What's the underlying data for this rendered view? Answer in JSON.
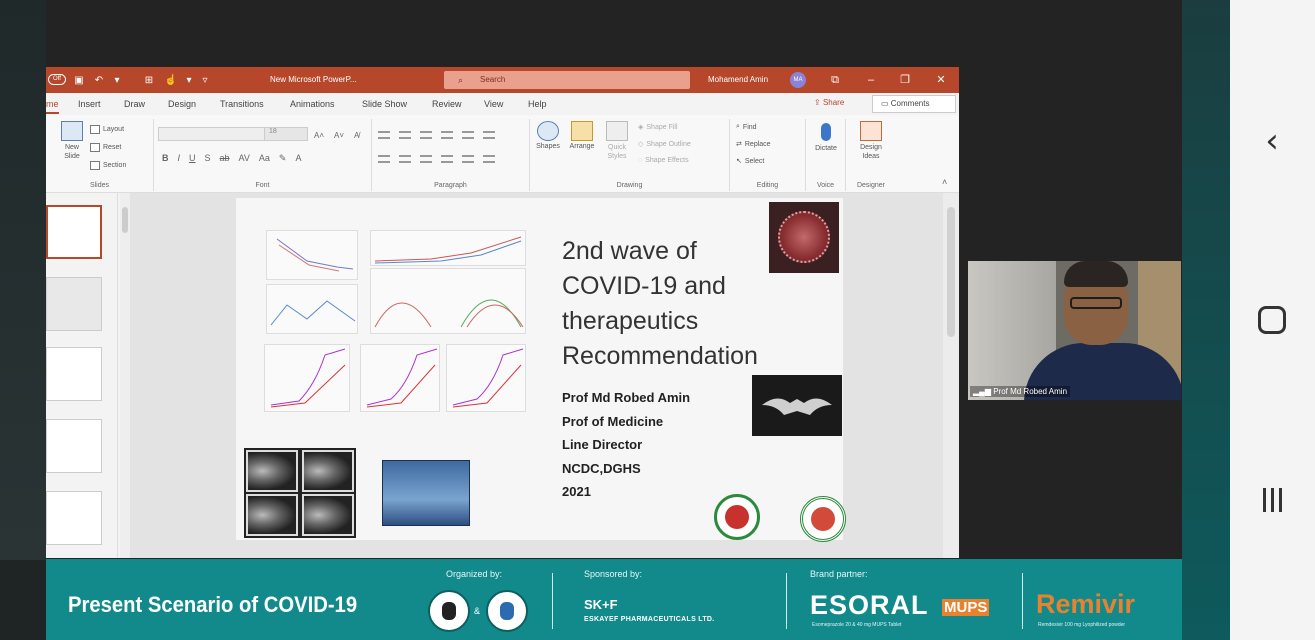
{
  "ppt": {
    "autosave": "Off",
    "doc_name": "New Microsoft PowerP...",
    "search_placeholder": "Search",
    "user_name": "Mohamend Amin",
    "user_initials": "MA",
    "tabs": [
      "me",
      "Insert",
      "Draw",
      "Design",
      "Transitions",
      "Animations",
      "Slide Show",
      "Review",
      "View",
      "Help"
    ],
    "share_label": "Share",
    "comments_label": "Comments",
    "ribbon": {
      "slides": {
        "new_slide": "New Slide",
        "layout": "Layout",
        "reset": "Reset",
        "section": "Section",
        "label": "Slides"
      },
      "font": {
        "size": "18",
        "label": "Font"
      },
      "paragraph": {
        "label": "Paragraph"
      },
      "drawing": {
        "shapes": "Shapes",
        "arrange": "Arrange",
        "quick_styles": "Quick Styles",
        "shape_fill": "Shape Fill",
        "shape_outline": "Shape Outline",
        "shape_effects": "Shape Effects",
        "label": "Drawing"
      },
      "editing": {
        "find": "Find",
        "replace": "Replace",
        "select": "Select",
        "label": "Editing"
      },
      "voice": {
        "dictate": "Dictate",
        "label": "Voice"
      },
      "designer": {
        "design_ideas": "Design Ideas",
        "label": "Designer"
      }
    },
    "slide": {
      "title_lines": [
        "2nd wave of",
        "COVID-19 and",
        "therapeutics",
        "Recommendation"
      ],
      "author_lines": [
        "Prof Md Robed Amin",
        "Prof of Medicine",
        "Line Director",
        "NCDC,DGHS",
        "2021"
      ]
    }
  },
  "video": {
    "participant": "Prof Md Robed Amin"
  },
  "banner": {
    "title": "Present Scenario of COVID-19",
    "organized_by": "Organized by:",
    "amp": "&",
    "sponsored_by": "Sponsored by:",
    "sponsor_name": "SK+F",
    "sponsor_full": "ESKAYEF PHARMACEUTICALS LTD.",
    "brand_partner": "Brand partner:",
    "brand1": "ESORAL",
    "brand1_suffix": "MUPS",
    "brand1_tagline": "Esomeprazole 20 & 40 mg MUPS Tablet",
    "brand2": "Remivir",
    "brand2_tagline": "Remdesivir 100 mg Lyophilized powder"
  },
  "colors": {
    "ppt_accent": "#b7472a",
    "banner": "#128a8c",
    "brand_orange": "#e8822e"
  },
  "icons": {
    "nav_back": "chevron-left-icon",
    "nav_home": "home-icon",
    "nav_recent": "recent-apps-icon"
  }
}
